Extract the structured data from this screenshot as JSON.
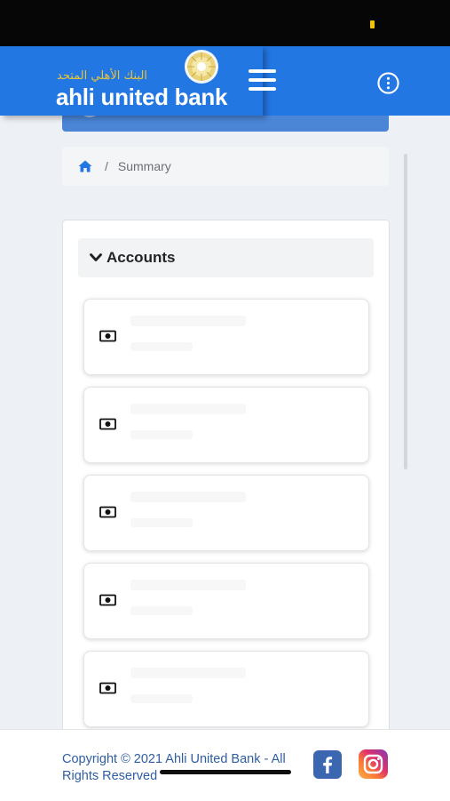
{
  "header": {
    "logo_arabic": "البنك الأهلي المتحد",
    "logo_text": "ahli united bank",
    "brand_color": "#2377e3",
    "icons": [
      "menu-icon",
      "info-icon"
    ]
  },
  "breadcrumb": {
    "home_icon": "home-icon",
    "separator": "/",
    "current": "Summary"
  },
  "accounts": {
    "title": "Accounts",
    "expanded": true,
    "items": [
      {
        "icon": "money-icon"
      },
      {
        "icon": "money-icon"
      },
      {
        "icon": "money-icon"
      },
      {
        "icon": "money-icon"
      },
      {
        "icon": "money-icon"
      }
    ]
  },
  "footer": {
    "copyright": "Copyright © 2021 Ahli United Bank - All Rights Reserved",
    "social": [
      "facebook-icon",
      "instagram-icon"
    ],
    "link_color": "#2f5ea3"
  },
  "status_bar": {
    "battery_color": "#f5c400"
  }
}
